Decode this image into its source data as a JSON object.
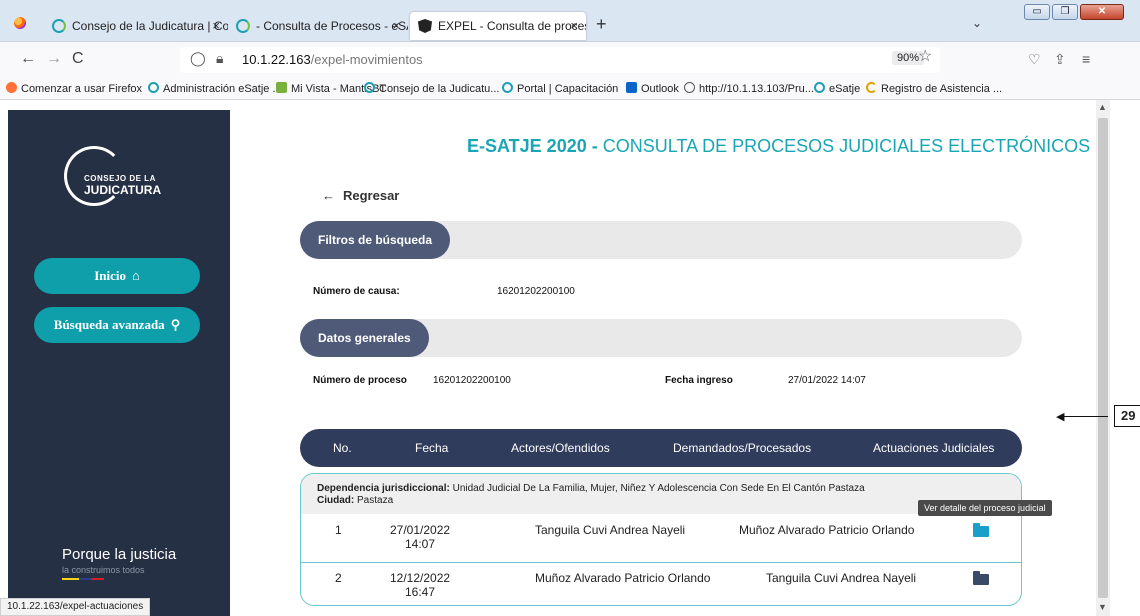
{
  "browser": {
    "tabs": [
      {
        "title": "Consejo de la Judicatura | Cons",
        "close": "×"
      },
      {
        "title": "- Consulta de Procesos - eSATJE",
        "close": "×"
      },
      {
        "title": "EXPEL - Consulta de procesos",
        "close": "×"
      }
    ],
    "new_tab": "+",
    "tabs_menu": "⌄",
    "window_controls": {
      "minimize": "▭",
      "maximize": "❐",
      "close": "✕"
    },
    "nav": {
      "back": "←",
      "forward": "→",
      "reload": "C"
    },
    "url_host": "10.1.22.163",
    "url_path": "/expel-movimientos",
    "zoom": "90%",
    "status_url": "10.1.22.163/expel-actuaciones"
  },
  "bookmarks": [
    "Comenzar a usar Firefox",
    "Administración eSatje ...",
    "Mi Vista - MantisBT",
    "Consejo de la Judicatu...",
    "Portal | Capacitación",
    "Outlook",
    "http://10.1.13.103/Pru...",
    "eSatje",
    "Registro de Asistencia ..."
  ],
  "sidebar": {
    "logo_line1": "CONSEJO DE LA",
    "logo_line2": "JUDICATURA",
    "btn_inicio": "Inicio",
    "btn_inicio_icon": "⌂",
    "btn_busqueda": "Búsqueda avanzada",
    "btn_busqueda_icon": "⚲",
    "slogan_line1": "Porque la justicia",
    "slogan_line2": "la construimos todos"
  },
  "main": {
    "title_bold": "E-SATJE 2020 -",
    "title_rest": " CONSULTA DE PROCESOS JUDICIALES ELECTRÓNICOS",
    "back_arrow": "←",
    "back_label": "Regresar",
    "filters_title": "Filtros de búsqueda",
    "numero_causa_label": "Número de causa:",
    "numero_causa_value": "16201202200100",
    "datos_title": "Datos generales",
    "numero_proceso_label": "Número de proceso",
    "numero_proceso_value": "16201202200100",
    "fecha_ingreso_label": "Fecha ingreso",
    "fecha_ingreso_value": "27/01/2022 14:07"
  },
  "table": {
    "headers": [
      "No.",
      "Fecha",
      "Actores/Ofendidos",
      "Demandados/Procesados",
      "Actuaciones Judiciales"
    ],
    "dependencia_label": "Dependencia jurisdiccional:",
    "dependencia_value": " Unidad Judicial De La Familia, Mujer, Niñez Y Adolescencia Con Sede En El Cantón Pastaza",
    "ciudad_label": "Ciudad:",
    "ciudad_value": " Pastaza",
    "rows": [
      {
        "no": "1",
        "fecha": "27/01/2022",
        "hora": "14:07",
        "actor": "Tanguila Cuvi Andrea Nayeli",
        "demandado": "Muñoz Alvarado Patricio Orlando",
        "folder_color": "#1a9fc9"
      },
      {
        "no": "2",
        "fecha": "12/12/2022",
        "hora": "16:47",
        "actor": "Muñoz Alvarado Patricio Orlando",
        "demandado": "Tanguila Cuvi Andrea Nayeli",
        "folder_color": "#3a4a66"
      }
    ],
    "tooltip": "Ver detalle del proceso judicial"
  },
  "annotation": {
    "callout": "29"
  },
  "colors": {
    "accent": "#19a6b4",
    "sidebar_bg": "#253044",
    "button": "#0e9fab",
    "table_header": "#2f3c5c"
  }
}
